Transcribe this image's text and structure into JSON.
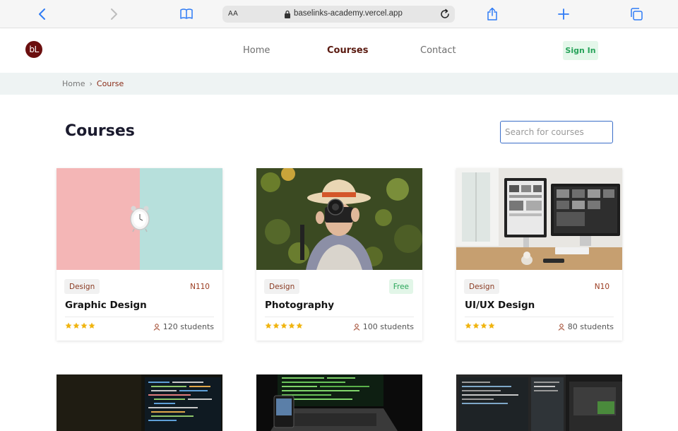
{
  "browser": {
    "aa_label": "AA",
    "url": "baselinks-academy.vercel.app"
  },
  "header": {
    "logo_text": "bL",
    "nav": [
      {
        "label": "Home"
      },
      {
        "label": "Courses"
      },
      {
        "label": "Contact"
      }
    ],
    "signin_label": "Sign In"
  },
  "breadcrumb": {
    "home": "Home",
    "separator": "›",
    "current": "Course"
  },
  "main": {
    "title": "Courses",
    "search_placeholder": "Search for courses"
  },
  "courses": [
    {
      "category": "Design",
      "price": "N110",
      "title": "Graphic Design",
      "rating": 4,
      "students": "120 students",
      "image": "alarm-clock-photo"
    },
    {
      "category": "Design",
      "price": "Free",
      "title": "Photography",
      "rating": 5,
      "students": "100 students",
      "image": "photographer-photo"
    },
    {
      "category": "Design",
      "price": "N10",
      "title": "UI/UX Design",
      "rating": 4,
      "students": "80 students",
      "image": "computer-monitors-photo"
    }
  ],
  "colors": {
    "accent_blue": "#2f7bf5",
    "brand": "#6b0f0f",
    "star": "#f0b40f",
    "free_green": "#2aa65a"
  }
}
